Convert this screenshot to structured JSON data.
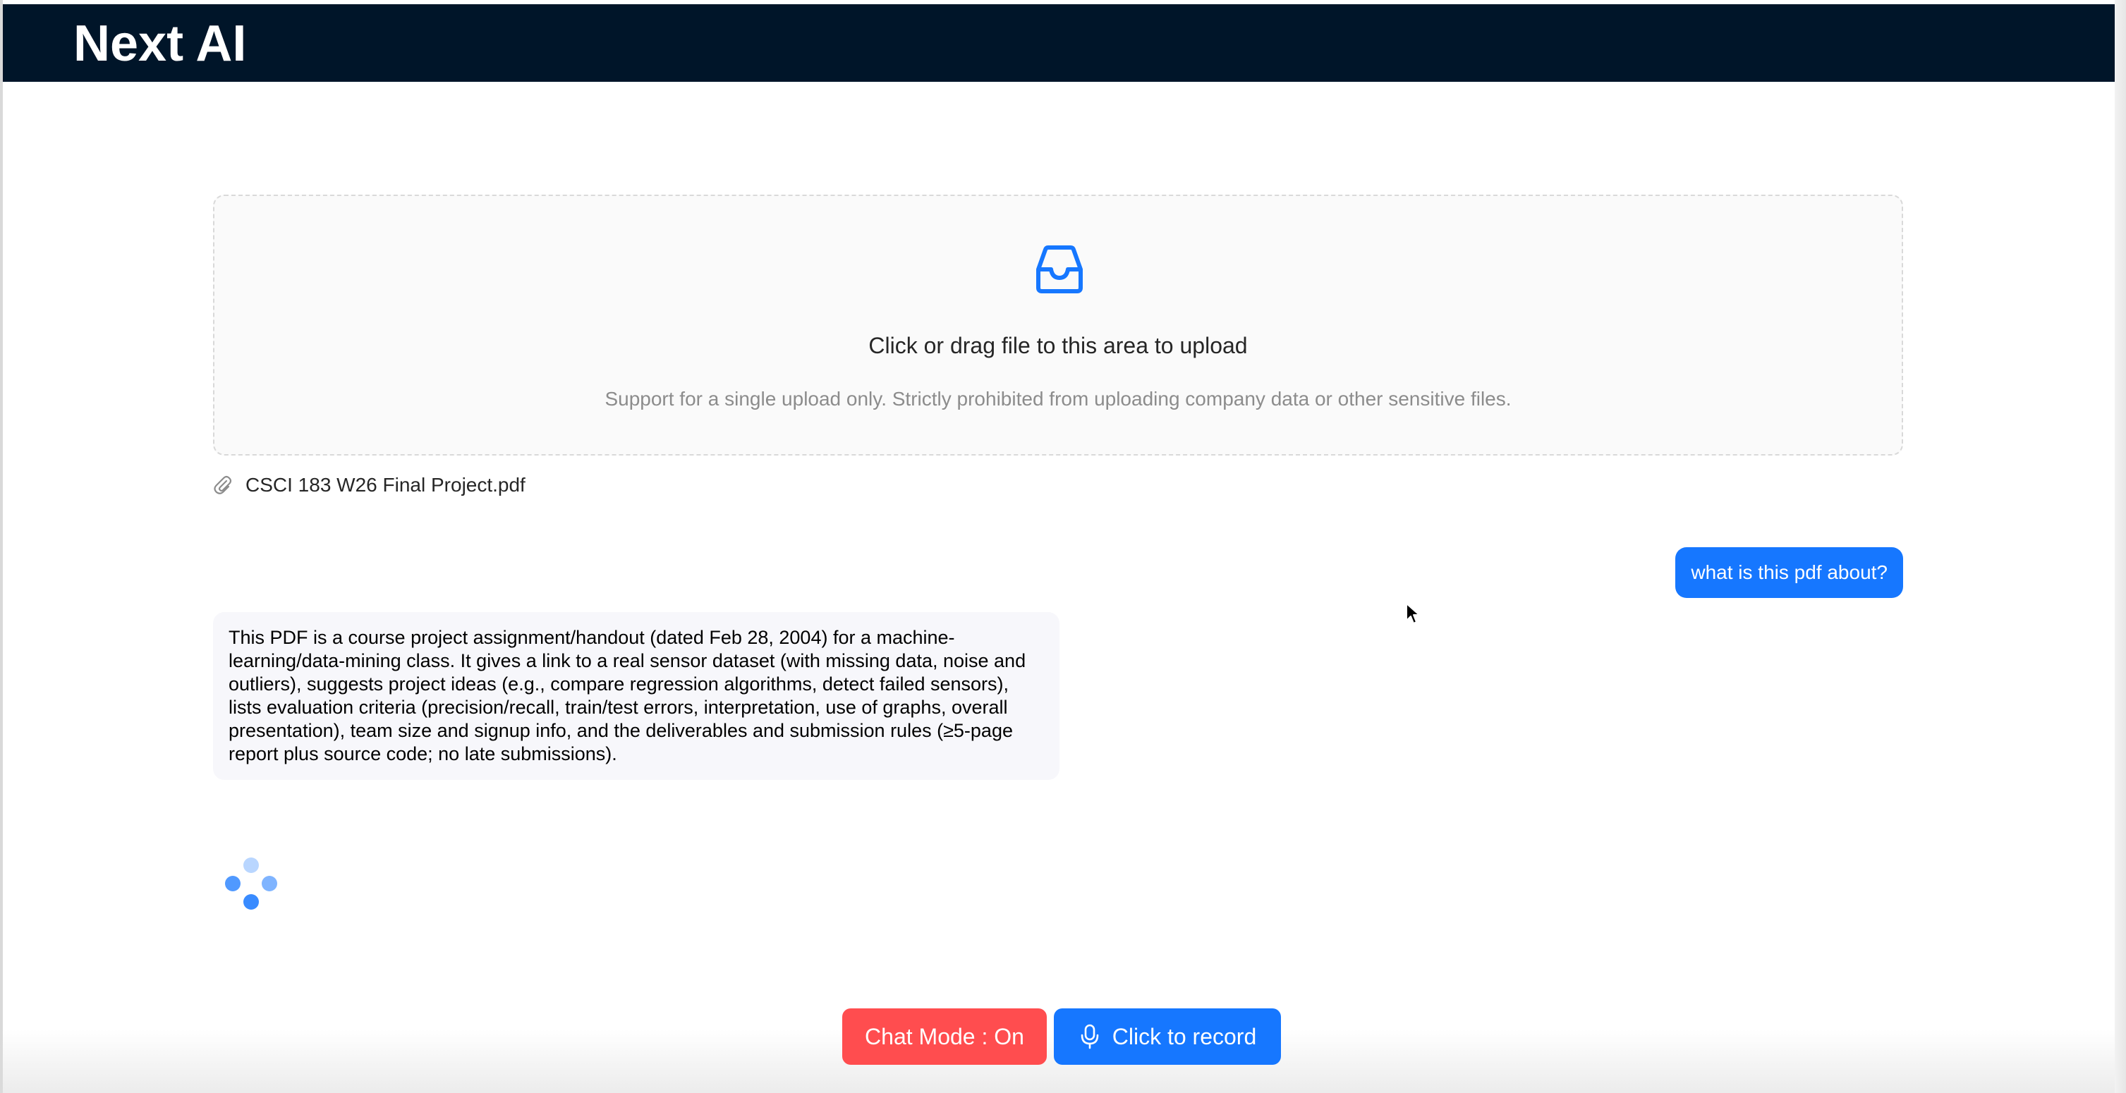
{
  "header": {
    "title": "Next AI"
  },
  "upload": {
    "prompt": "Click or drag file to this area to upload",
    "hint": "Support for a single upload only. Strictly prohibited from uploading company data or other sensitive files.",
    "icon": "inbox-icon"
  },
  "file": {
    "name": "CSCI 183 W26 Final Project.pdf",
    "icon": "paperclip-icon"
  },
  "chat": {
    "user_message": "what is this pdf about?",
    "ai_message": "This PDF is a course project assignment/handout (dated Feb 28, 2004) for a machine-learning/data-mining class. It gives a link to a real sensor dataset (with missing data, noise and outliers), suggests project ideas (e.g., compare regression algorithms, detect failed sensors), lists evaluation criteria (precision/recall, train/test errors, interpretation, use of graphs, overall presentation), team size and signup info, and the deliverables and submission rules (≥5-page report plus source code; no late submissions)."
  },
  "controls": {
    "chat_mode_label": "Chat Mode : On",
    "record_label": "Click to record",
    "record_icon": "microphone-icon"
  },
  "colors": {
    "header_bg": "#001529",
    "primary": "#1677ff",
    "danger": "#ff4d4f",
    "upload_bg": "#fafafa",
    "ai_bubble_bg": "#f7f7fb"
  }
}
